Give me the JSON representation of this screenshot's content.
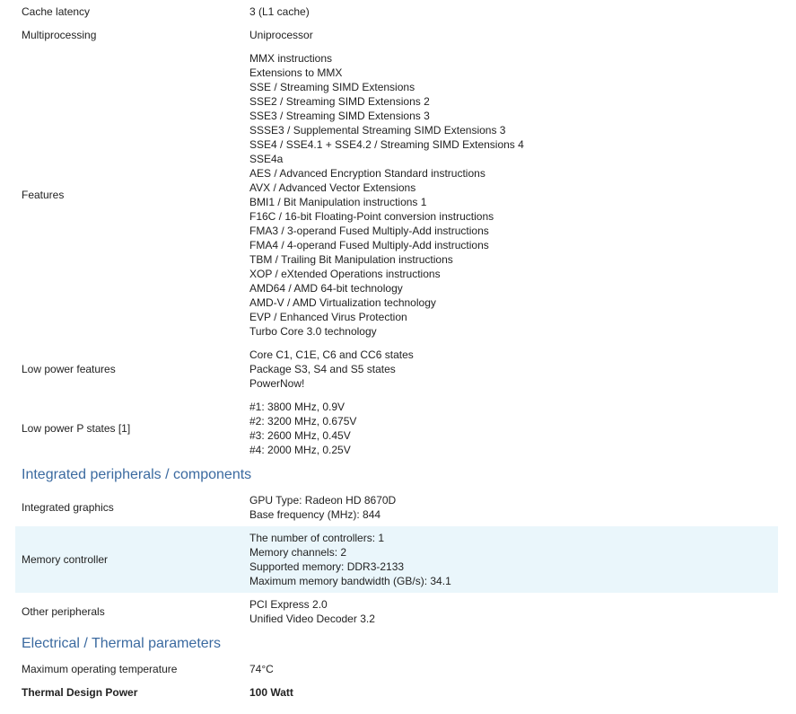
{
  "rows_top": [
    {
      "label": "Cache latency",
      "values": [
        "3 (L1 cache)"
      ]
    },
    {
      "label": "Multiprocessing",
      "values": [
        "Uniprocessor"
      ]
    },
    {
      "label": "Features",
      "values": [
        "MMX instructions",
        "Extensions to MMX",
        "SSE / Streaming SIMD Extensions",
        "SSE2 / Streaming SIMD Extensions 2",
        "SSE3 / Streaming SIMD Extensions 3",
        "SSSE3 / Supplemental Streaming SIMD Extensions 3",
        "SSE4 / SSE4.1 + SSE4.2 / Streaming SIMD Extensions 4",
        "SSE4a",
        "AES / Advanced Encryption Standard instructions",
        "AVX / Advanced Vector Extensions",
        "BMI1 / Bit Manipulation instructions 1",
        "F16C / 16-bit Floating-Point conversion instructions",
        "FMA3 / 3-operand Fused Multiply-Add instructions",
        "FMA4 / 4-operand Fused Multiply-Add instructions",
        "TBM / Trailing Bit Manipulation instructions",
        "XOP / eXtended Operations instructions",
        "AMD64 / AMD 64-bit technology",
        "AMD-V / AMD Virtualization technology",
        "EVP / Enhanced Virus Protection",
        "Turbo Core 3.0 technology"
      ]
    },
    {
      "label": "Low power features",
      "values": [
        "Core C1, C1E, C6 and CC6 states",
        "Package S3, S4 and S5 states",
        "PowerNow!"
      ]
    },
    {
      "label": "Low power P states [1]",
      "values": [
        "#1: 3800 MHz, 0.9V",
        "#2: 3200 MHz, 0.675V",
        "#3: 2600 MHz, 0.45V",
        "#4: 2000 MHz, 0.25V"
      ]
    }
  ],
  "section_peripherals": "Integrated peripherals / components",
  "rows_peripherals": [
    {
      "label": "Integrated graphics",
      "values": [
        "GPU Type: Radeon HD 8670D",
        "Base frequency (MHz): 844"
      ]
    },
    {
      "label": "Memory controller",
      "values": [
        "The number of controllers: 1",
        "Memory channels: 2",
        "Supported memory: DDR3-2133",
        "Maximum memory bandwidth (GB/s): 34.1"
      ]
    },
    {
      "label": "Other peripherals",
      "values": [
        "PCI Express 2.0",
        "Unified Video Decoder 3.2"
      ]
    }
  ],
  "section_electrical": "Electrical / Thermal parameters",
  "rows_electrical": [
    {
      "label": "Maximum operating temperature",
      "values": [
        "74°C"
      ]
    },
    {
      "label": "Thermal Design Power",
      "values": [
        "100 Watt"
      ]
    }
  ]
}
